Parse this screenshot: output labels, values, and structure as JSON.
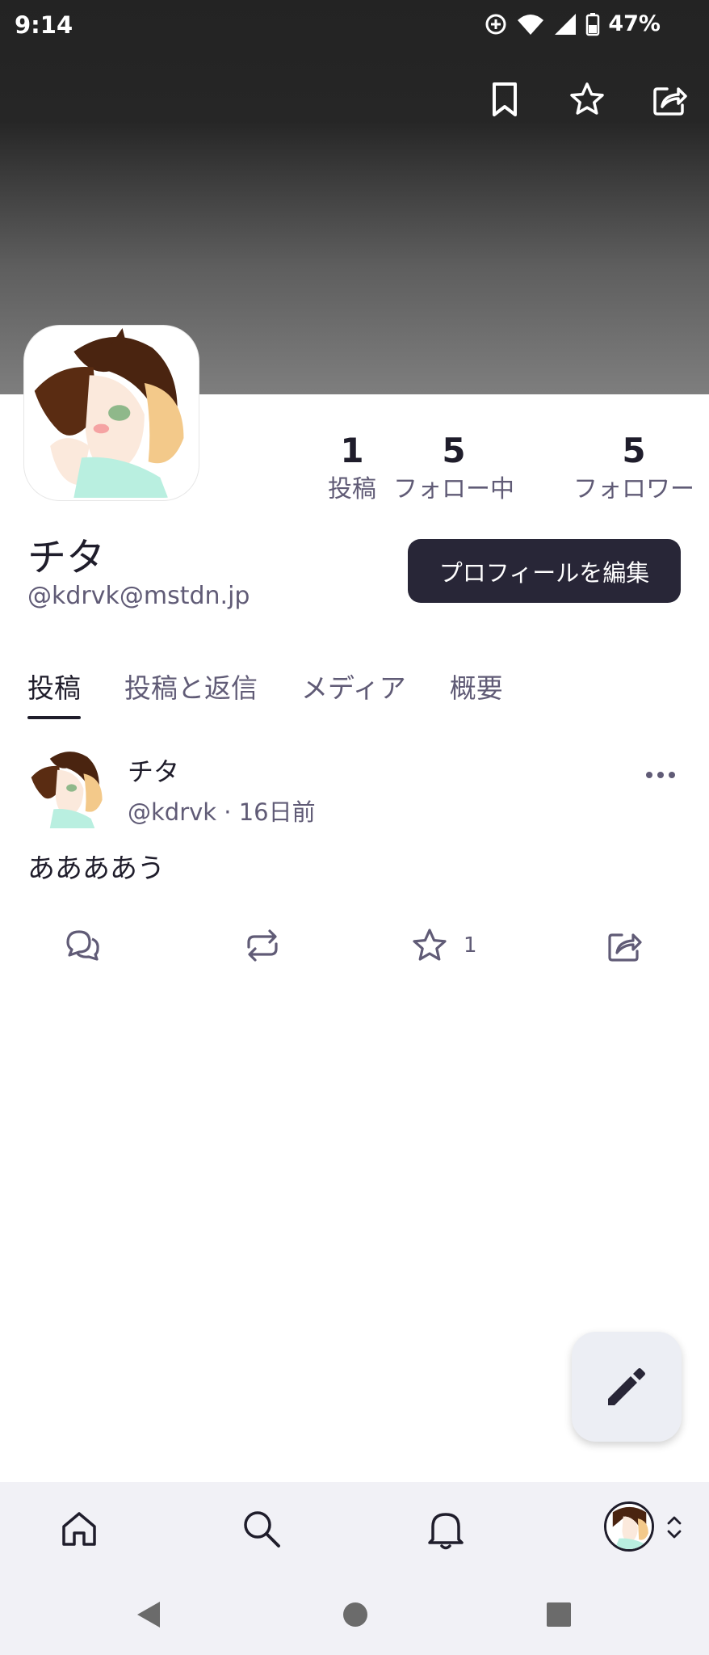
{
  "status_bar": {
    "time": "9:14",
    "battery": "47%"
  },
  "profile": {
    "display_name": "チタ",
    "acct": "@kdrvk@mstdn.jp",
    "edit_button": "プロフィールを編集",
    "stats": [
      {
        "value": "1",
        "label": "投稿"
      },
      {
        "value": "5",
        "label": "フォロー中"
      },
      {
        "value": "5",
        "label": "フォロワー"
      }
    ]
  },
  "tabs": [
    "投稿",
    "投稿と返信",
    "メディア",
    "概要"
  ],
  "active_tab": "投稿",
  "post": {
    "name": "チタ",
    "meta": "@kdrvk · 16日前",
    "text": "ああああう",
    "favourite_count": "1"
  },
  "icons": {
    "top": [
      "bookmark-icon",
      "star-icon",
      "share-icon"
    ],
    "post_actions": [
      "reply-icon",
      "boost-icon",
      "star-icon",
      "share-icon"
    ],
    "bottom_nav": [
      "home-icon",
      "search-icon",
      "bell-icon"
    ]
  },
  "colors": {
    "accent_dark": "#282637",
    "text": "#1f1d2b",
    "muted": "#605b76"
  }
}
